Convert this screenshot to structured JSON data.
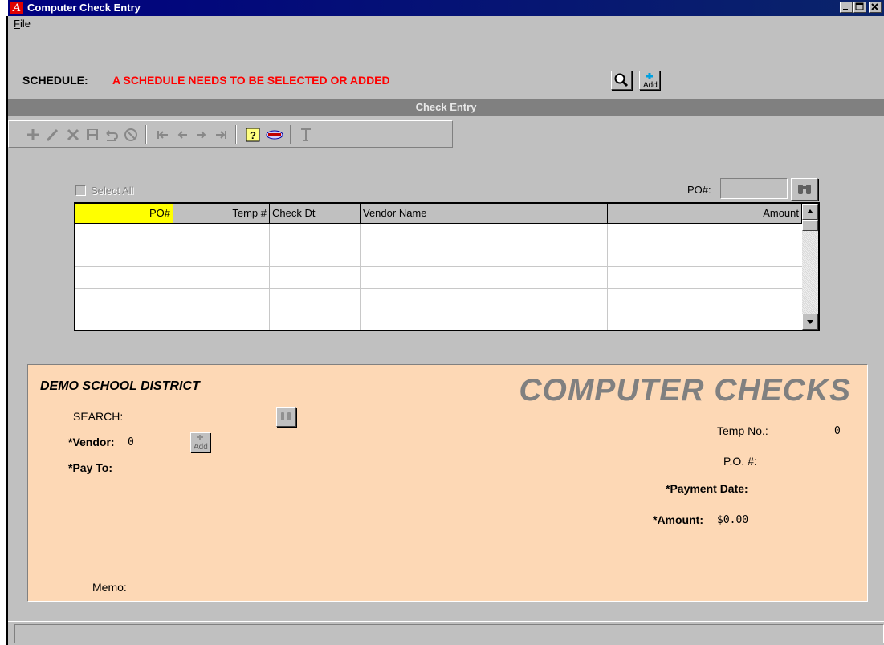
{
  "window": {
    "title": "Computer Check Entry",
    "app_icon_letter": "A",
    "controls": [
      "minimize",
      "maximize",
      "close"
    ]
  },
  "menu": {
    "file_mnemonic": "F",
    "file_rest": "ile"
  },
  "schedule": {
    "label": "SCHEDULE:",
    "message": "A SCHEDULE NEEDS TO BE SELECTED OR ADDED",
    "message_color": "#ff0000",
    "add_label": "Add"
  },
  "check_entry": {
    "header": "Check Entry",
    "toolbar_icons": [
      "add-icon",
      "edit-icon",
      "delete-icon",
      "save-icon",
      "undo-icon",
      "cancel-icon",
      "first-record-icon",
      "previous-record-icon",
      "next-record-icon",
      "last-record-icon",
      "help-icon",
      "logo-icon",
      "filter-icon"
    ]
  },
  "grid": {
    "select_all_label": "Select All",
    "po_search_label": "PO#:",
    "po_search_value": "",
    "columns": [
      "PO#",
      "Temp #",
      "Check Dt",
      "Vendor Name",
      "Amount"
    ],
    "rows": []
  },
  "check": {
    "district": "DEMO SCHOOL DISTRICT",
    "title": "COMPUTER CHECKS",
    "search_label": "SEARCH:",
    "vendor_label": "*Vendor:",
    "vendor_value": "0",
    "pay_to_label": "*Pay To:",
    "memo_label": "Memo:",
    "temp_no_label": "Temp No.:",
    "temp_no_value": "0",
    "po_label": "P.O. #:",
    "po_value": "",
    "payment_date_label": "*Payment Date:",
    "payment_date_value": "",
    "amount_label": "*Amount:",
    "amount_value": "$0.00",
    "add_label": "Add"
  },
  "colors": {
    "title_bar": "#000080",
    "panel_background": "#fdd8b5",
    "active_header": "#ffff00",
    "section_bar": "#808080"
  }
}
